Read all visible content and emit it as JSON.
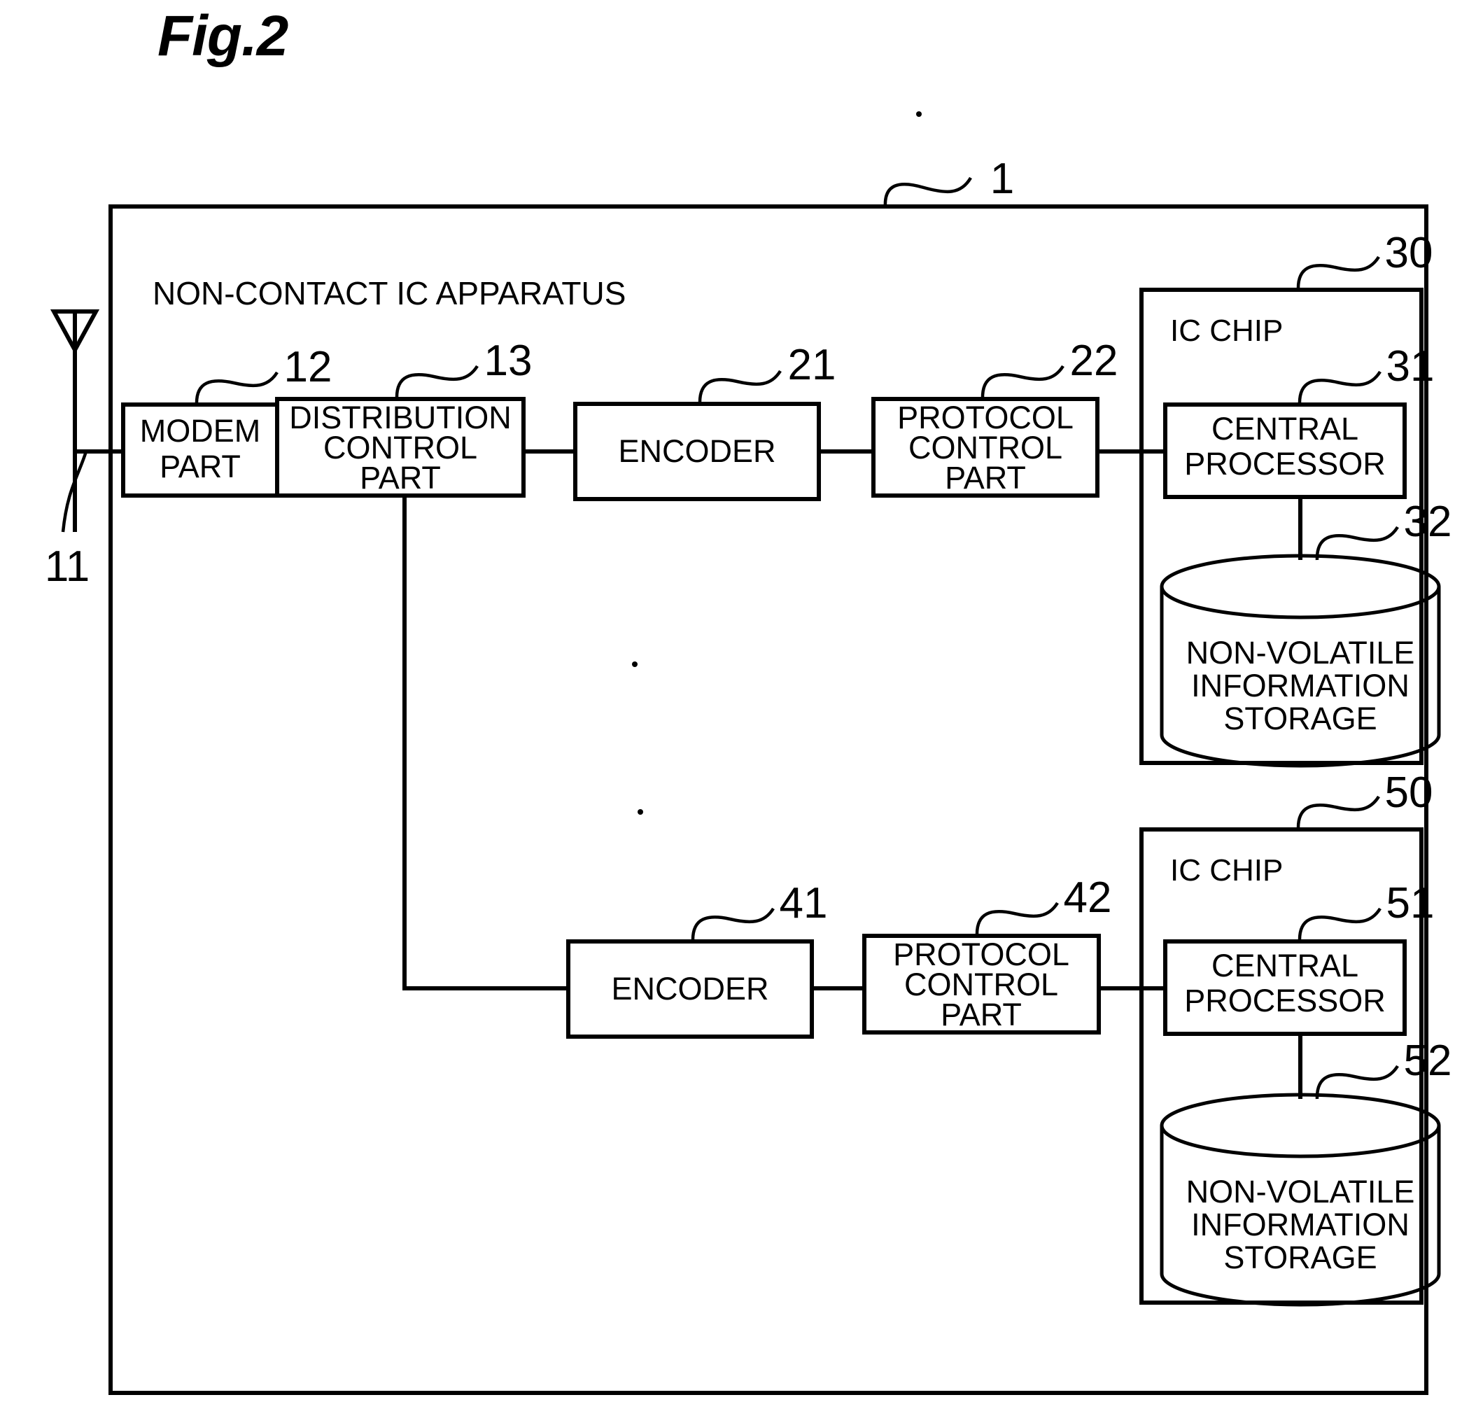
{
  "figure": {
    "title": "Fig.2",
    "apparatus_label": "NON-CONTACT IC APPARATUS",
    "outer_ref": "1"
  },
  "antenna": {
    "name": "antenna-symbol",
    "ref": "11"
  },
  "blocks": {
    "modem_part": {
      "label": "MODEM PART",
      "line1": "MODEM",
      "line2": "PART",
      "ref": "12"
    },
    "distribution_control_part": {
      "label": "DISTRIBUTION CONTROL PART",
      "line1": "DISTRIBUTION",
      "line2": "CONTROL",
      "line3": "PART",
      "ref": "13"
    },
    "encoder_top": {
      "label": "ENCODER",
      "ref": "21"
    },
    "protocol_control_part_top": {
      "label": "PROTOCOL CONTROL PART",
      "line1": "PROTOCOL",
      "line2": "CONTROL",
      "line3": "PART",
      "ref": "22"
    },
    "ic_chip_top": {
      "label": "IC CHIP",
      "ref": "30"
    },
    "central_processor_top": {
      "label": "CENTRAL PROCESSOR",
      "line1": "CENTRAL",
      "line2": "PROCESSOR",
      "ref": "31"
    },
    "storage_top": {
      "label": "NON-VOLATILE INFORMATION STORAGE",
      "line1": "NON-VOLATILE",
      "line2": "INFORMATION",
      "line3": "STORAGE",
      "ref": "32"
    },
    "encoder_bottom": {
      "label": "ENCODER",
      "ref": "41"
    },
    "protocol_control_part_bottom": {
      "label": "PROTOCOL CONTROL PART",
      "line1": "PROTOCOL",
      "line2": "CONTROL",
      "line3": "PART",
      "ref": "42"
    },
    "ic_chip_bottom": {
      "label": "IC CHIP",
      "ref": "50"
    },
    "central_processor_bottom": {
      "label": "CENTRAL PROCESSOR",
      "line1": "CENTRAL",
      "line2": "PROCESSOR",
      "ref": "51"
    },
    "storage_bottom": {
      "label": "NON-VOLATILE INFORMATION STORAGE",
      "line1": "NON-VOLATILE",
      "line2": "INFORMATION",
      "line3": "STORAGE",
      "ref": "52"
    }
  },
  "colors": {
    "ink": "#000000",
    "paper": "#ffffff"
  }
}
